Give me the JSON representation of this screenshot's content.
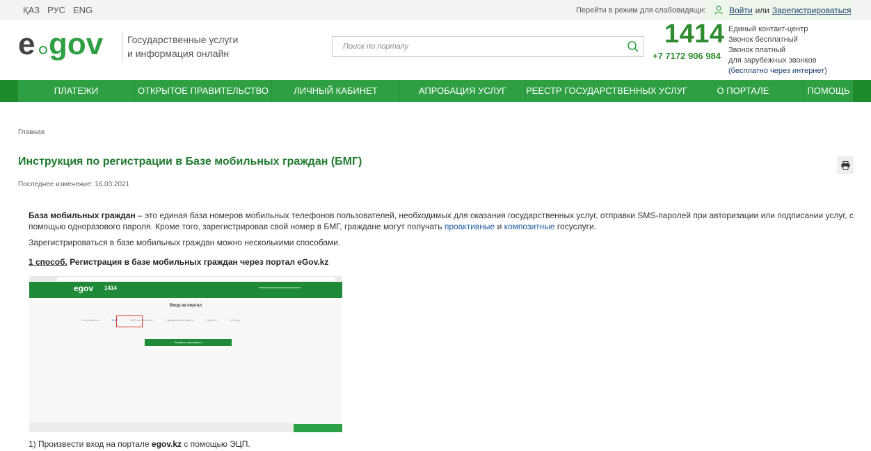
{
  "topbar": {
    "languages": [
      "ҚАЗ",
      "РУС",
      "ENG"
    ],
    "visually_impaired": "Перейти в режим для слабовидящих",
    "login": "Войти",
    "or": "или",
    "register": "Зарегистрироваться"
  },
  "header": {
    "logo_text": "egov",
    "tagline_line1": "Государственные услуги",
    "tagline_line2": "и информация онлайн",
    "search_placeholder": "Поиск по порталу",
    "contact_number": "1414",
    "phone": "+7 7172 906 984",
    "contact_lines": [
      "Единый контакт-центр",
      "Звонок бесплатный",
      "Звонок платный",
      "для зарубежных звонков",
      "(бесплатно через интернет)"
    ]
  },
  "nav": {
    "items": [
      "ПЛАТЕЖИ",
      "ОТКРЫТОЕ ПРАВИТЕЛЬСТВО",
      "ЛИЧНЫЙ КАБИНЕТ",
      "АПРОБАЦИЯ УСЛУГ",
      "РЕЕСТР ГОСУДАРСТВЕННЫХ УСЛУГ",
      "О ПОРТАЛЕ",
      "ПОМОЩЬ"
    ]
  },
  "content": {
    "breadcrumb": "Главная",
    "title": "Инструкция по регистрации в Базе мобильных граждан (БМГ)",
    "last_modified": "Последнее изменение: 16.03.2021",
    "para1_bold": "База мобильных граждан",
    "para1_text": " – это единая база номеров мобильных телефонов пользователей, необходимых для оказания государственных услуг, отправки SMS-паролей при авторизации или подписании услуг, с помощью одноразового пароля. Кроме того, зарегистрировав свой номер в БМГ, граждане могут получать ",
    "para1_link1": "проактивные",
    "para1_and": " и ",
    "para1_link2": "композитные",
    "para1_end": " госуслуги.",
    "para2": "Зарегистрироваться в базе мобильных граждан можно несколькими способами.",
    "step1_label": "1 способ.",
    "step1_title": " Регистрация в базе мобильных граждан через портал eGov.kz",
    "caption_pre": "1) Произвести вход на портале ",
    "caption_bold": "egov.kz",
    "caption_post": " с помощью ЭЦП."
  },
  "screenshot": {
    "logo": "egov",
    "number": "1414",
    "title": "Вход на портал",
    "tabs": [
      "Логин/пароль",
      "ЭЦП",
      "ЭЦП на SIM-карте",
      "Одноразовый пароль",
      "Digital ID",
      "QR-код"
    ],
    "button": "Выбрать сертификат"
  },
  "colors": {
    "brand_green": "#2ea043",
    "nav_dark": "#1d8a2c",
    "title_green": "#1f7a2e",
    "link_blue": "#1a5a9e"
  }
}
